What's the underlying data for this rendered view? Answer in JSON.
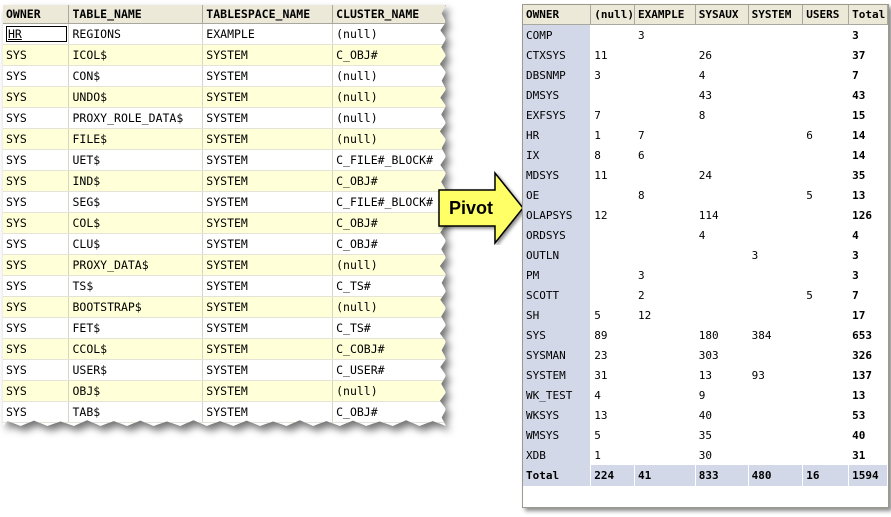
{
  "left_grid": {
    "columns": [
      "OWNER",
      "TABLE_NAME",
      "TABLESPACE_NAME",
      "CLUSTER_NAME"
    ],
    "rows": [
      [
        "HR",
        "REGIONS",
        "EXAMPLE",
        "(null)"
      ],
      [
        "SYS",
        "ICOL$",
        "SYSTEM",
        "C_OBJ#"
      ],
      [
        "SYS",
        "CON$",
        "SYSTEM",
        "(null)"
      ],
      [
        "SYS",
        "UNDO$",
        "SYSTEM",
        "(null)"
      ],
      [
        "SYS",
        "PROXY_ROLE_DATA$",
        "SYSTEM",
        "(null)"
      ],
      [
        "SYS",
        "FILE$",
        "SYSTEM",
        "(null)"
      ],
      [
        "SYS",
        "UET$",
        "SYSTEM",
        "C_FILE#_BLOCK#"
      ],
      [
        "SYS",
        "IND$",
        "SYSTEM",
        "C_OBJ#"
      ],
      [
        "SYS",
        "SEG$",
        "SYSTEM",
        "C_FILE#_BLOCK#"
      ],
      [
        "SYS",
        "COL$",
        "SYSTEM",
        "C_OBJ#"
      ],
      [
        "SYS",
        "CLU$",
        "SYSTEM",
        "C_OBJ#"
      ],
      [
        "SYS",
        "PROXY_DATA$",
        "SYSTEM",
        "(null)"
      ],
      [
        "SYS",
        "TS$",
        "SYSTEM",
        "C_TS#"
      ],
      [
        "SYS",
        "BOOTSTRAP$",
        "SYSTEM",
        "(null)"
      ],
      [
        "SYS",
        "FET$",
        "SYSTEM",
        "C_TS#"
      ],
      [
        "SYS",
        "CCOL$",
        "SYSTEM",
        "C_COBJ#"
      ],
      [
        "SYS",
        "USER$",
        "SYSTEM",
        "C_USER#"
      ],
      [
        "SYS",
        "OBJ$",
        "SYSTEM",
        "(null)"
      ],
      [
        "SYS",
        "TAB$",
        "SYSTEM",
        "C_OBJ#"
      ]
    ]
  },
  "arrow": {
    "label": "Pivot",
    "fill": "#ffff66"
  },
  "right_grid": {
    "columns": [
      "OWNER",
      "(null)",
      "EXAMPLE",
      "SYSAUX",
      "SYSTEM",
      "USERS",
      "Total"
    ],
    "rows": [
      [
        "COMP",
        "",
        "3",
        "",
        "",
        "",
        "3"
      ],
      [
        "CTXSYS",
        "11",
        "",
        "26",
        "",
        "",
        "37"
      ],
      [
        "DBSNMP",
        "3",
        "",
        "4",
        "",
        "",
        "7"
      ],
      [
        "DMSYS",
        "",
        "",
        "43",
        "",
        "",
        "43"
      ],
      [
        "EXFSYS",
        "7",
        "",
        "8",
        "",
        "",
        "15"
      ],
      [
        "HR",
        "1",
        "7",
        "",
        "",
        "6",
        "14"
      ],
      [
        "IX",
        "8",
        "6",
        "",
        "",
        "",
        "14"
      ],
      [
        "MDSYS",
        "11",
        "",
        "24",
        "",
        "",
        "35"
      ],
      [
        "OE",
        "",
        "8",
        "",
        "",
        "5",
        "13"
      ],
      [
        "OLAPSYS",
        "12",
        "",
        "114",
        "",
        "",
        "126"
      ],
      [
        "ORDSYS",
        "",
        "",
        "4",
        "",
        "",
        "4"
      ],
      [
        "OUTLN",
        "",
        "",
        "",
        "3",
        "",
        "3"
      ],
      [
        "PM",
        "",
        "3",
        "",
        "",
        "",
        "3"
      ],
      [
        "SCOTT",
        "",
        "2",
        "",
        "",
        "5",
        "7"
      ],
      [
        "SH",
        "5",
        "12",
        "",
        "",
        "",
        "17"
      ],
      [
        "SYS",
        "89",
        "",
        "180",
        "384",
        "",
        "653"
      ],
      [
        "SYSMAN",
        "23",
        "",
        "303",
        "",
        "",
        "326"
      ],
      [
        "SYSTEM",
        "31",
        "",
        "13",
        "93",
        "",
        "137"
      ],
      [
        "WK_TEST",
        "4",
        "",
        "9",
        "",
        "",
        "13"
      ],
      [
        "WKSYS",
        "13",
        "",
        "40",
        "",
        "",
        "53"
      ],
      [
        "WMSYS",
        "5",
        "",
        "35",
        "",
        "",
        "40"
      ],
      [
        "XDB",
        "1",
        "",
        "30",
        "",
        "",
        "31"
      ]
    ],
    "total_row": [
      "Total",
      "224",
      "41",
      "833",
      "480",
      "16",
      "1594"
    ]
  },
  "colors": {
    "row_stripe": "#ffffd8",
    "header_bg": "#ece9d8",
    "owner_bg": "#d2d8e8"
  }
}
